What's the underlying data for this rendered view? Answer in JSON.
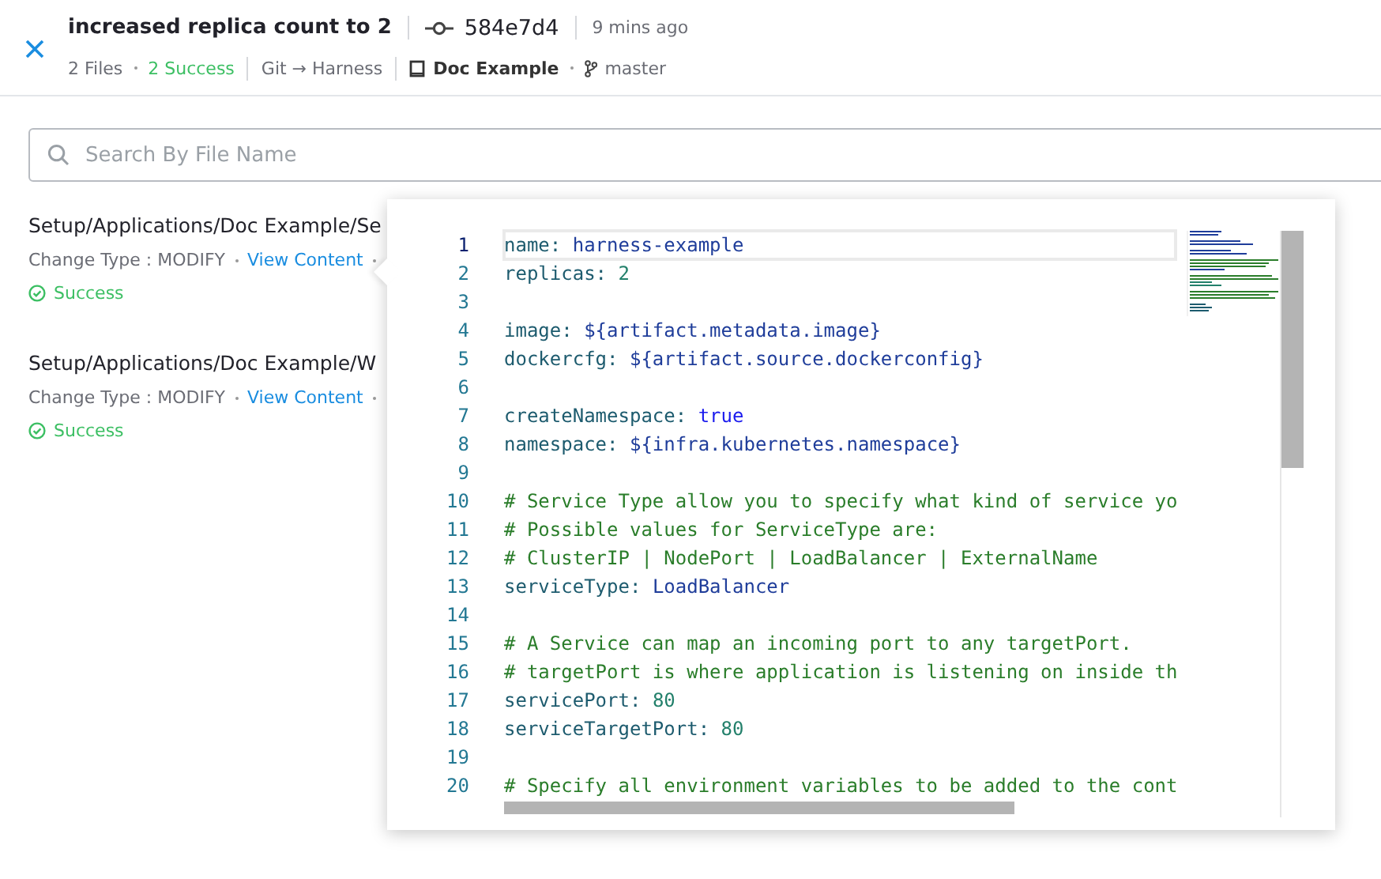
{
  "header": {
    "title": "increased replica count to 2",
    "commit": "584e7d4",
    "time": "9 mins ago",
    "files": "2 Files",
    "success": "2 Success",
    "sync": "Git → Harness",
    "repo": "Doc Example",
    "branch": "master"
  },
  "search": {
    "placeholder": "Search By File Name"
  },
  "files": [
    {
      "path": "Setup/Applications/Doc Example/Se",
      "change_type": "Change Type : MODIFY",
      "link": "View Content",
      "status": {
        "text": "Success",
        "kind": "success"
      }
    },
    {
      "path": "Setup/Applications/Doc Example/W",
      "change_type": "Change Type : MODIFY",
      "link": "View Content",
      "status": {
        "text": "Success",
        "kind": "success"
      }
    }
  ],
  "editor": {
    "lines": [
      {
        "number": "1",
        "selected": true,
        "tokens": [
          {
            "text": "name",
            "kind": "key"
          },
          {
            "text": ": ",
            "kind": "punct"
          },
          {
            "text": "harness-example",
            "kind": "value"
          }
        ]
      },
      {
        "number": "2",
        "selected": false,
        "tokens": [
          {
            "text": "replicas",
            "kind": "key"
          },
          {
            "text": ": ",
            "kind": "punct"
          },
          {
            "text": "2",
            "kind": "number"
          }
        ]
      },
      {
        "number": "3",
        "selected": false
      },
      {
        "number": "4",
        "selected": false,
        "tokens": [
          {
            "text": "image",
            "kind": "key"
          },
          {
            "text": ": ",
            "kind": "punct"
          },
          {
            "text": "${artifact.metadata.image}",
            "kind": "value"
          }
        ]
      },
      {
        "number": "5",
        "selected": false,
        "tokens": [
          {
            "text": "dockercfg",
            "kind": "key"
          },
          {
            "text": ": ",
            "kind": "punct"
          },
          {
            "text": "${artifact.source.dockerconfig}",
            "kind": "value"
          }
        ]
      },
      {
        "number": "6",
        "selected": false
      },
      {
        "number": "7",
        "selected": false,
        "tokens": [
          {
            "text": "createNamespace",
            "kind": "key"
          },
          {
            "text": ": ",
            "kind": "punct"
          },
          {
            "text": "true",
            "kind": "bool"
          }
        ]
      },
      {
        "number": "8",
        "selected": false,
        "tokens": [
          {
            "text": "namespace",
            "kind": "key"
          },
          {
            "text": ": ",
            "kind": "punct"
          },
          {
            "text": "${infra.kubernetes.namespace}",
            "kind": "value"
          }
        ]
      },
      {
        "number": "9",
        "selected": false
      },
      {
        "number": "10",
        "selected": false,
        "tokens": [
          {
            "text": "# Service Type allow you to specify what kind of service yo",
            "kind": "comment"
          }
        ]
      },
      {
        "number": "11",
        "selected": false,
        "tokens": [
          {
            "text": "# Possible values for ServiceType are:",
            "kind": "comment"
          }
        ]
      },
      {
        "number": "12",
        "selected": false,
        "tokens": [
          {
            "text": "# ClusterIP | NodePort | LoadBalancer | ExternalName",
            "kind": "comment"
          }
        ]
      },
      {
        "number": "13",
        "selected": false,
        "tokens": [
          {
            "text": "serviceType",
            "kind": "key"
          },
          {
            "text": ": ",
            "kind": "punct"
          },
          {
            "text": "LoadBalancer",
            "kind": "value"
          }
        ]
      },
      {
        "number": "14",
        "selected": false
      },
      {
        "number": "15",
        "selected": false,
        "tokens": [
          {
            "text": "# A Service can map an incoming port to any targetPort.",
            "kind": "comment"
          }
        ]
      },
      {
        "number": "16",
        "selected": false,
        "tokens": [
          {
            "text": "# targetPort is where application is listening on inside th",
            "kind": "comment"
          }
        ]
      },
      {
        "number": "17",
        "selected": false,
        "tokens": [
          {
            "text": "servicePort",
            "kind": "key"
          },
          {
            "text": ": ",
            "kind": "punct"
          },
          {
            "text": "80",
            "kind": "number"
          }
        ]
      },
      {
        "number": "18",
        "selected": false,
        "tokens": [
          {
            "text": "serviceTargetPort",
            "kind": "key"
          },
          {
            "text": ": ",
            "kind": "punct"
          },
          {
            "text": "80",
            "kind": "number"
          }
        ]
      },
      {
        "number": "19",
        "selected": false
      },
      {
        "number": "20",
        "selected": false,
        "tokens": [
          {
            "text": "# Specify all environment variables to be added to the cont",
            "kind": "comment"
          }
        ]
      }
    ]
  }
}
